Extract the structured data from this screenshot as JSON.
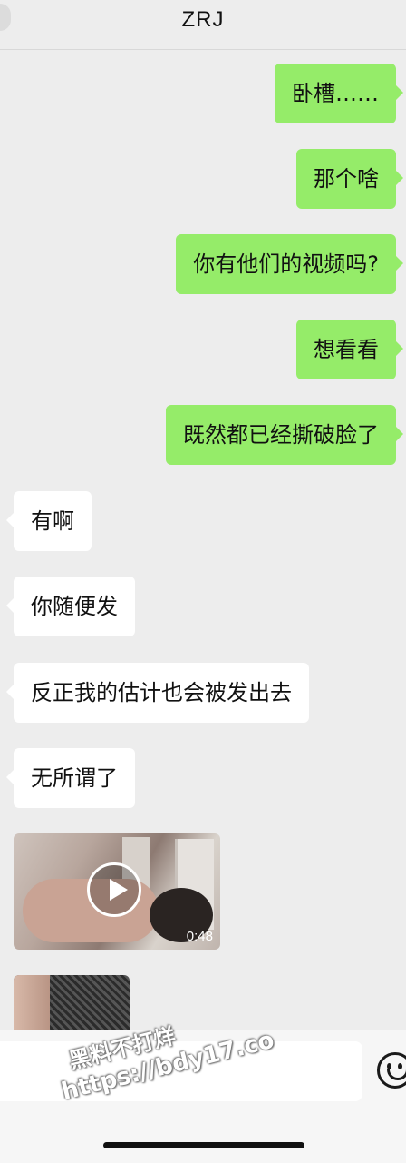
{
  "header": {
    "title": "ZRJ"
  },
  "messages": [
    {
      "side": "out",
      "text": "卧槽……"
    },
    {
      "side": "out",
      "text": "那个啥"
    },
    {
      "side": "out",
      "text": "你有他们的视频吗?"
    },
    {
      "side": "out",
      "text": "想看看"
    },
    {
      "side": "out",
      "text": "既然都已经撕破脸了"
    },
    {
      "side": "in",
      "text": "有啊"
    },
    {
      "side": "in",
      "text": "你随便发"
    },
    {
      "side": "in",
      "text": "反正我的估计也会被发出去"
    },
    {
      "side": "in",
      "text": "无所谓了"
    }
  ],
  "video_message": {
    "duration": "0:48",
    "icon": "play-icon"
  },
  "image_message": {
    "icon": "image-thumbnail"
  },
  "input_bar": {
    "placeholder": "",
    "emoji_icon": "emoji-icon"
  },
  "watermark": {
    "line1": "黑料不打烊",
    "line2": "https://bdy17.co"
  },
  "colors": {
    "outgoing_bubble": "#95ec69",
    "incoming_bubble": "#ffffff",
    "background": "#ededed"
  }
}
